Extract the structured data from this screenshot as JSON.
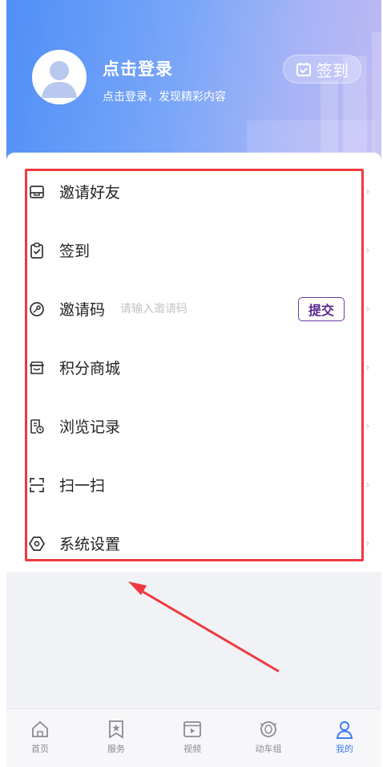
{
  "colors": {
    "accent": "#3e7cf5",
    "header_gradient_start": "#4f8ff7",
    "header_gradient_end": "#c1b9f3",
    "highlight": "#ee3a3f",
    "submit_border": "#6b3aa0"
  },
  "header": {
    "title": "点击登录",
    "subtitle": "点击登录，发现精彩内容",
    "checkin_label": "签到",
    "checkin_icon": "calendar-check-icon",
    "avatar_icon": "user-avatar-icon"
  },
  "menu": {
    "items": [
      {
        "label": "邀请好友",
        "icon": "invite-envelope-icon"
      },
      {
        "label": "签到",
        "icon": "clipboard-check-icon"
      },
      {
        "label": "邀请码",
        "icon": "key-icon",
        "input_placeholder": "请输入邀请码",
        "input_value": "",
        "button_label": "提交"
      },
      {
        "label": "积分商城",
        "icon": "store-icon"
      },
      {
        "label": "浏览记录",
        "icon": "history-doc-icon"
      },
      {
        "label": "扫一扫",
        "icon": "scan-icon"
      },
      {
        "label": "系统设置",
        "icon": "settings-hexagon-icon"
      }
    ]
  },
  "bottom_nav": {
    "items": [
      {
        "label": "首页",
        "icon": "home-icon",
        "active": false
      },
      {
        "label": "服务",
        "icon": "bookmark-star-icon",
        "active": false
      },
      {
        "label": "视频",
        "icon": "video-icon",
        "active": false
      },
      {
        "label": "动车组",
        "icon": "train-icon",
        "active": false
      },
      {
        "label": "我的",
        "icon": "profile-icon",
        "active": true
      }
    ]
  }
}
